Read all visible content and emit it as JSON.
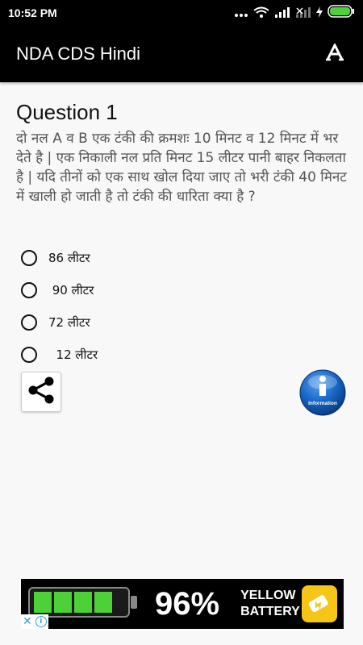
{
  "status_bar": {
    "time": "10:52 PM",
    "icons": [
      "more-dots-icon",
      "wifi-icon",
      "signal-icon",
      "no-signal-icon",
      "charging-icon",
      "battery-icon"
    ]
  },
  "app_bar": {
    "title": "NDA CDS Hindi",
    "font_icon": "font-size-icon"
  },
  "question": {
    "title": "Question 1",
    "text": "दो नल A व B एक टंकी की क्रमशः 10 मिनट व 12 मिनट में भर देते है | एक निकाली नल प्रति मिनट 15 लीटर पानी बाहर निकलता है | यदि तीनों को एक साथ खोल दिया जाए तो भरी टंकी 40 मिनट में खाली हो जाती है तो टंकी की धारिता क्या है ?",
    "options": [
      "86 लीटर",
      " 90 लीटर",
      "72 लीटर",
      "  12 लीटर"
    ]
  },
  "buttons": {
    "share_icon": "share-icon",
    "info_label": "Information"
  },
  "ad": {
    "percent": "96%",
    "brand_line1": "YELLOW",
    "brand_line2": "BATTERY"
  },
  "colors": {
    "app_bar_bg": "#000000",
    "page_bg": "#f8f8f8",
    "question_text": "#555555",
    "info_blue": "#1565c0",
    "battery_green": "#4cd137",
    "ad_yellow": "#f5c617"
  }
}
